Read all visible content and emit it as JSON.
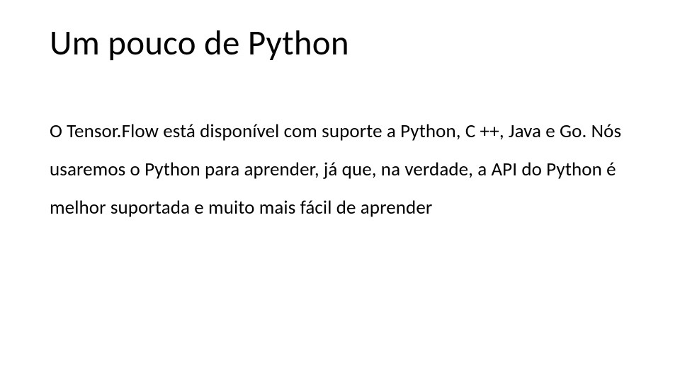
{
  "slide": {
    "title": "Um pouco de Python",
    "body": "O Tensor.Flow está disponível com suporte a Python, C ++, Java e Go. Nós usaremos o Python para aprender, já que, na verdade, a API do Python é melhor suportada e muito mais fácil de aprender"
  }
}
